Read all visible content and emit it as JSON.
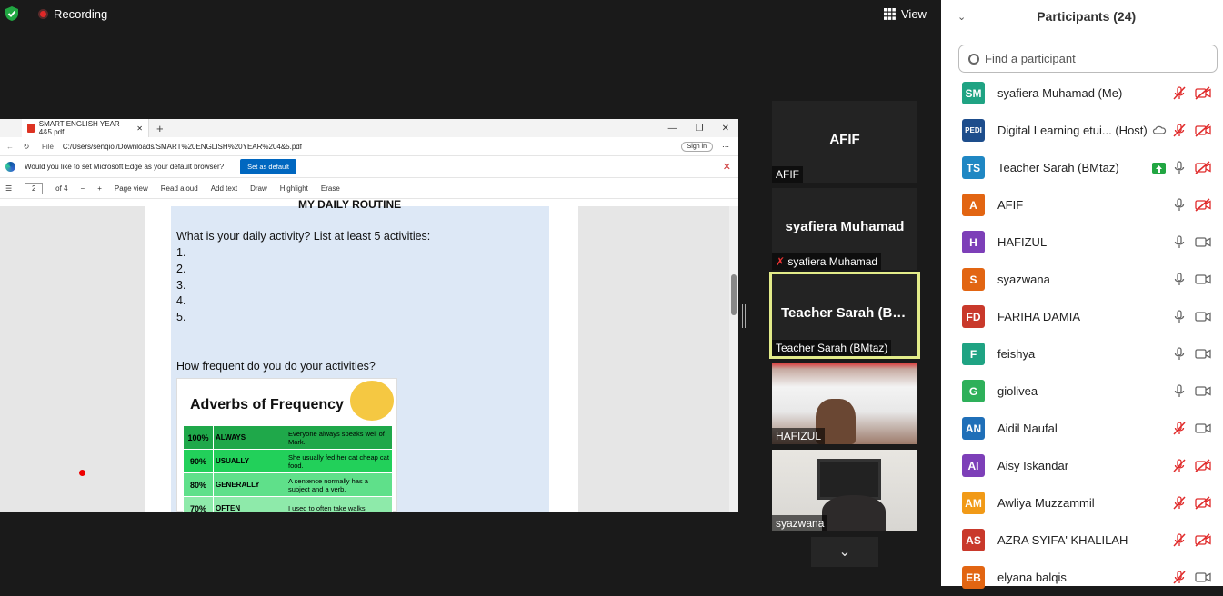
{
  "toolbar": {
    "recording": "Recording",
    "view": "View"
  },
  "browser": {
    "tab_title": "SMART ENGLISH YEAR 4&5.pdf",
    "file_label": "File",
    "url": "C:/Users/senqioi/Downloads/SMART%20ENGLISH%20YEAR%204&5.pdf",
    "signin": "Sign in",
    "banner_text": "Would you like to set Microsoft Edge as your default browser?",
    "banner_button": "Set as default",
    "page_num": "2",
    "page_of": "of 4",
    "tools": [
      "Page view",
      "Read aloud",
      "Add text",
      "Draw",
      "Highlight",
      "Erase"
    ]
  },
  "doc": {
    "heading": "MY DAILY ROUTINE",
    "question1": "What is your daily activity? List at least 5 activities:",
    "items": [
      "1.",
      "2.",
      "3.",
      "4.",
      "5."
    ],
    "question2": "How frequent do you do your activities?",
    "adv_title": "Adverbs of Frequency",
    "adv_rows": [
      {
        "pct": "100%",
        "word": "ALWAYS",
        "ex": "Everyone always speaks well of Mark.",
        "color": "#1fa84a"
      },
      {
        "pct": "90%",
        "word": "USUALLY",
        "ex": "She usually fed her cat cheap cat food.",
        "color": "#22d05a"
      },
      {
        "pct": "80%",
        "word": "GENERALLY",
        "ex": "A sentence normally has a subject and a verb.",
        "color": "#5fe08a"
      },
      {
        "pct": "70%",
        "word": "OFTEN",
        "ex": "I used to often take walks",
        "color": "#8eeaaa"
      }
    ]
  },
  "videos": {
    "t1_big": "AFIF",
    "t1_name": "AFIF",
    "t2_big": "syafiera Muhamad",
    "t2_name": "syafiera Muhamad",
    "t3_big": "Teacher Sarah (BMtaz)",
    "t3_name": "Teacher Sarah (BMtaz)",
    "t4_name": "HAFIZUL",
    "t5_name": "syazwana"
  },
  "panel": {
    "title": "Participants (24)",
    "search_placeholder": "Find a participant",
    "participants": [
      {
        "initials": "SM",
        "name": "syafiera Muhamad (Me)",
        "color": "#1fa383",
        "mic": "muted",
        "cam": "off"
      },
      {
        "initials": "PEDI",
        "name": "Digital Learning etui... (Host)",
        "color": "#1d4d8c",
        "mic": "muted",
        "cam": "off"
      },
      {
        "initials": "TS",
        "name": "Teacher Sarah (BMtaz)",
        "color": "#1f87c3",
        "mic": "on",
        "cam": "off"
      },
      {
        "initials": "A",
        "name": "AFIF",
        "color": "#e26512",
        "mic": "on",
        "cam": "off"
      },
      {
        "initials": "H",
        "name": "HAFIZUL",
        "color": "#7d3fb8",
        "mic": "on",
        "cam": "on"
      },
      {
        "initials": "S",
        "name": "syazwana",
        "color": "#e26512",
        "mic": "on",
        "cam": "on"
      },
      {
        "initials": "FD",
        "name": "FARIHA DAMIA",
        "color": "#c9392b",
        "mic": "on",
        "cam": "on"
      },
      {
        "initials": "F",
        "name": "feishya",
        "color": "#1fa383",
        "mic": "on",
        "cam": "on"
      },
      {
        "initials": "G",
        "name": "giolivea",
        "color": "#2eb05a",
        "mic": "on",
        "cam": "on"
      },
      {
        "initials": "AN",
        "name": "Aidil Naufal",
        "color": "#1f6fb8",
        "mic": "muted",
        "cam": "on"
      },
      {
        "initials": "AI",
        "name": "Aisy Iskandar",
        "color": "#7d3fb8",
        "mic": "muted",
        "cam": "off"
      },
      {
        "initials": "AM",
        "name": "Awliya Muzzammil",
        "color": "#f19a17",
        "mic": "muted",
        "cam": "off"
      },
      {
        "initials": "AS",
        "name": "AZRA SYIFA' KHALILAH",
        "color": "#c9392b",
        "mic": "muted",
        "cam": "off"
      },
      {
        "initials": "EB",
        "name": "elyana balqis",
        "color": "#e26512",
        "mic": "muted",
        "cam": "on"
      }
    ]
  }
}
